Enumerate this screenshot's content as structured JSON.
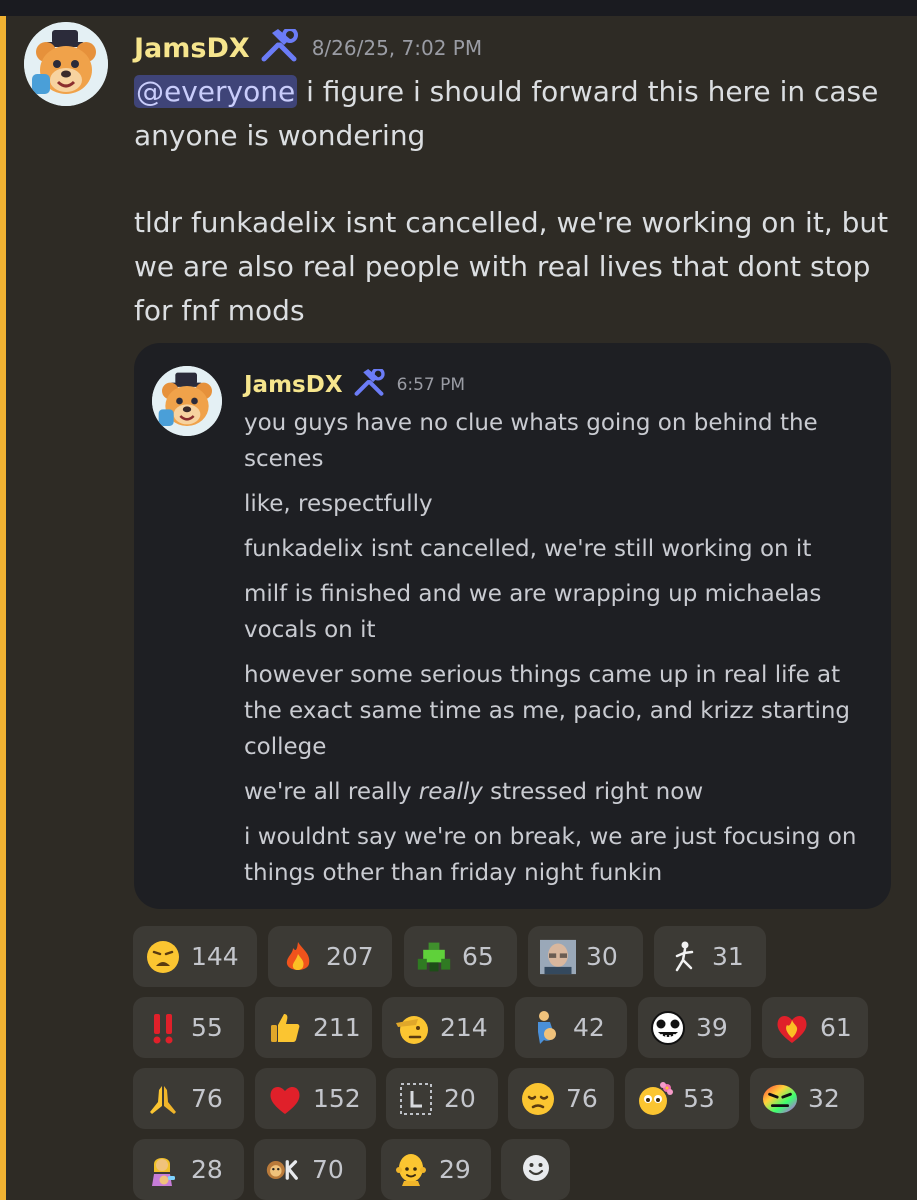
{
  "message": {
    "author": "JamsDX",
    "timestamp": "8/26/25, 7:02 PM",
    "mention": "@everyone",
    "line1_rest": " i figure i should forward this here in case anyone is wondering",
    "line2": "tldr funkadelix isnt cancelled, we're working on it, but we are also real people with real lives that dont stop for fnf mods"
  },
  "forwarded": {
    "author": "JamsDX",
    "timestamp": "6:57 PM",
    "lines": [
      "you guys have no clue whats going on behind the scenes",
      "like, respectfully",
      "funkadelix isnt cancelled, we're still working on it",
      "milf is finished and we are wrapping up michaelas vocals on it",
      "however some serious things came up in real life at the exact same time as me, pacio, and krizz starting college"
    ],
    "line_italic_pre": "we're all really ",
    "line_italic_em": "really",
    "line_italic_post": " stressed right now",
    "last_line": "i wouldnt say we're on break, we are just focusing on things other than friday night funkin"
  },
  "reactions": [
    {
      "icon": "weary-face-icon",
      "count": "144"
    },
    {
      "icon": "fire-icon",
      "count": "207"
    },
    {
      "icon": "green-robot-emote-icon",
      "count": "65"
    },
    {
      "icon": "bald-man-photo-emote-icon",
      "count": "30"
    },
    {
      "icon": "stick-figure-emote-icon",
      "count": "31"
    },
    {
      "icon": "double-exclamation-icon",
      "count": "55"
    },
    {
      "icon": "thumbs-up-icon",
      "count": "211"
    },
    {
      "icon": "saluting-face-icon",
      "count": "214"
    },
    {
      "icon": "pregnant-man-icon",
      "count": "42"
    },
    {
      "icon": "skull-face-emote-icon",
      "count": "39"
    },
    {
      "icon": "heart-on-fire-icon",
      "count": "61"
    },
    {
      "icon": "folded-hands-icon",
      "count": "76"
    },
    {
      "icon": "red-heart-icon",
      "count": "152"
    },
    {
      "icon": "l-box-emote-icon",
      "count": "20"
    },
    {
      "icon": "pensive-face-icon",
      "count": "76"
    },
    {
      "icon": "face-holding-back-tears-flower-icon",
      "count": "53"
    },
    {
      "icon": "rainbow-angry-face-emote-icon",
      "count": "32"
    },
    {
      "icon": "woman-feeding-baby-icon",
      "count": "28"
    },
    {
      "icon": "ok-monkey-emote-icon",
      "count": "70"
    },
    {
      "icon": "bald-person-icon",
      "count": "29"
    }
  ],
  "add_reaction_icon": "add-reaction-icon",
  "colors": {
    "background": "#2e2b25",
    "accent_bar": "#f0b232",
    "username": "#f6e58d",
    "forward_box": "#1e1f23",
    "reaction_chip": "#3c3a35",
    "mention_bg": "#3f4478"
  }
}
